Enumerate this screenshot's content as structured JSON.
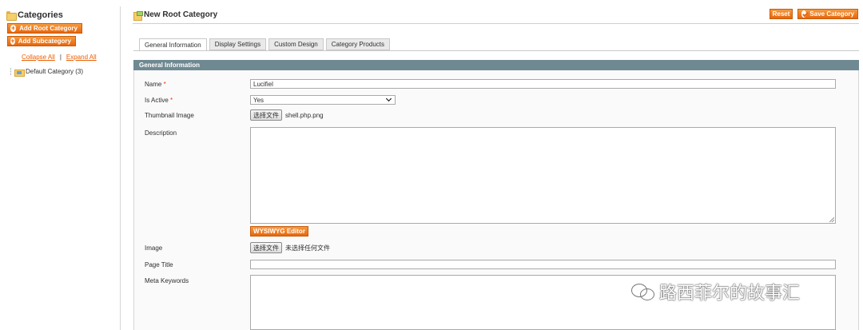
{
  "sidebar": {
    "title": "Categories",
    "add_root_label": "Add Root Category",
    "add_sub_label": "Add Subcategory",
    "collapse_all": "Collapse All",
    "separator": "|",
    "expand_all": "Expand All",
    "tree": [
      {
        "label": "Default Category (3)"
      }
    ]
  },
  "header": {
    "title": "New Root Category",
    "reset_label": "Reset",
    "save_label": "Save Category"
  },
  "tabs": [
    {
      "label": "General Information",
      "active": true
    },
    {
      "label": "Display Settings",
      "active": false
    },
    {
      "label": "Custom Design",
      "active": false
    },
    {
      "label": "Category Products",
      "active": false
    }
  ],
  "form": {
    "section_title": "General Information",
    "name": {
      "label": "Name",
      "required_mark": "*",
      "value": "Lucifiel"
    },
    "is_active": {
      "label": "Is Active",
      "required_mark": "*",
      "value": "Yes"
    },
    "thumbnail": {
      "label": "Thumbnail Image",
      "button": "选择文件",
      "file": "shell.php.png"
    },
    "description": {
      "label": "Description",
      "value": ""
    },
    "wysiwyg_label": "WYSIWYG Editor",
    "image": {
      "label": "Image",
      "button": "选择文件",
      "file": "未选择任何文件"
    },
    "page_title": {
      "label": "Page Title",
      "value": ""
    },
    "meta_keywords": {
      "label": "Meta Keywords",
      "value": ""
    }
  },
  "watermark": {
    "text": "路西菲尔的故事汇"
  },
  "colors": {
    "accent": "#e8660d",
    "section_header": "#6f8992",
    "link": "#eb5e00"
  }
}
